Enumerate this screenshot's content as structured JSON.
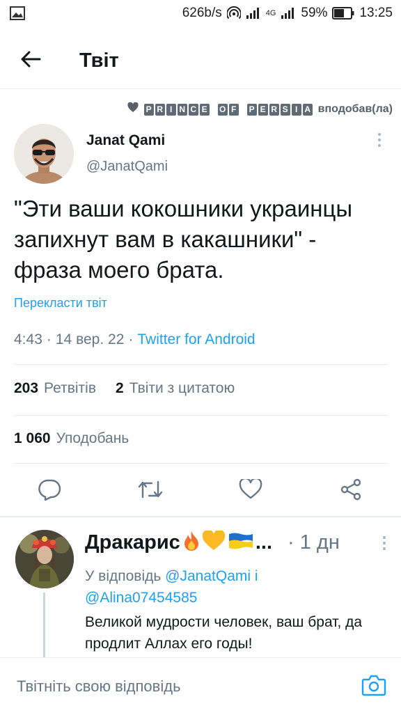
{
  "status_bar": {
    "speed": "626b/s",
    "network": "4G",
    "battery": "59%",
    "time": "13:25"
  },
  "header": {
    "title": "Твіт"
  },
  "liked_by": {
    "name_words": [
      [
        "P",
        "R",
        "I",
        "N",
        "C",
        "E"
      ],
      [
        "O",
        "F"
      ],
      [
        "P",
        "E",
        "R",
        "S",
        "I",
        "A"
      ]
    ],
    "suffix": "вподобав(ла)"
  },
  "tweet": {
    "author_name": "Janat Qami",
    "author_handle": "@JanatQami",
    "text": "\"Эти ваши кокошники украинцы запихнут вам в какашники\" - фраза моего брата.",
    "translate_label": "Перекласти твіт",
    "time": "4:43",
    "date": "14 вер. 22",
    "source": "Twitter for Android",
    "separator": "·",
    "retweets_count": "203",
    "retweets_label": "Ретвітів",
    "quotes_count": "2",
    "quotes_label": "Твіти з цитатою",
    "likes_count": "1 060",
    "likes_label": "Уподобань"
  },
  "actions": {
    "reply_icon": "reply-icon",
    "retweet_icon": "retweet-icon",
    "like_icon": "heart-icon",
    "share_icon": "share-icon"
  },
  "reply": {
    "author_name": "Дракарис",
    "emoji": [
      "🔥",
      "💛",
      "🇺🇦"
    ],
    "ellipsis": "...",
    "time": "· 1 дн",
    "reply_prefix": "У відповідь",
    "mention_1": "@JanatQami",
    "conjunction": "і",
    "mention_2": "@Alina07454585",
    "text": "Великой мудрости человек, ваш брат, да продлит Аллах его годы!"
  },
  "compose": {
    "placeholder": "Твітніть свою відповідь"
  },
  "colors": {
    "accent": "#1da1f2",
    "secondary_text": "#657786",
    "primary_text": "#14171a",
    "divider": "#e6ecf0"
  }
}
